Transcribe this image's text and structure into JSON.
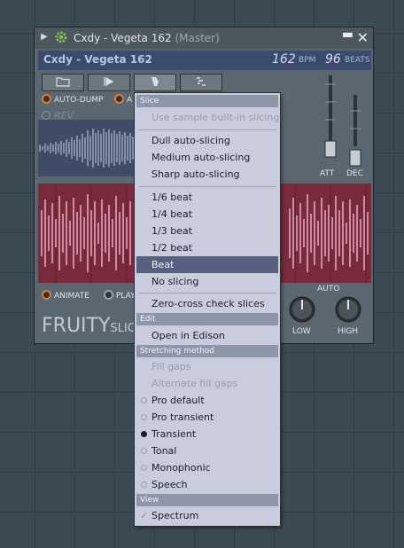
{
  "window": {
    "title": "Cxdy - Vegeta 162",
    "title_suffix": "(Master)",
    "header_name": "Cxdy - Vegeta 162",
    "bpm_value": "162",
    "bpm_label": "BPM",
    "beats_value": "96",
    "beats_label": "BEATS"
  },
  "toolbar": {
    "auto_dump": "AUTO-DUMP",
    "auto_second": "A"
  },
  "rev_label": "REV",
  "faders": {
    "att": "ATT",
    "dec": "DEC"
  },
  "bottom": {
    "animate": "ANIMATE",
    "play": "PLAY",
    "logo_main": "FRUITY",
    "logo_sub": "SLICER",
    "auto": "AUTO",
    "low": "LOW",
    "high": "HIGH"
  },
  "menu": {
    "slice_header": "Slice",
    "use_builtin": "Use sample built-in slicing",
    "dull": "Dull auto-slicing",
    "medium": "Medium auto-slicing",
    "sharp": "Sharp auto-slicing",
    "b16": "1/6 beat",
    "b14": "1/4 beat",
    "b13": "1/3 beat",
    "b12": "1/2 beat",
    "beat": "Beat",
    "no_slicing": "No slicing",
    "zero_cross": "Zero-cross check slices",
    "edit_header": "Edit",
    "open_edison": "Open in Edison",
    "stretch_header": "Stretching method",
    "fill_gaps": "Fill gaps",
    "alt_fill_gaps": "Alternate fill gaps",
    "pro_default": "Pro default",
    "pro_transient": "Pro transient",
    "transient": "Transient",
    "tonal": "Tonal",
    "monophonic": "Monophonic",
    "speech": "Speech",
    "view_header": "View",
    "spectrum": "Spectrum"
  },
  "colors": {
    "accent": "#566080",
    "waveform_bg": "#7b2a3e",
    "waveform_fg": "#f0b8c8",
    "header_bg": "#3c4a6e"
  }
}
